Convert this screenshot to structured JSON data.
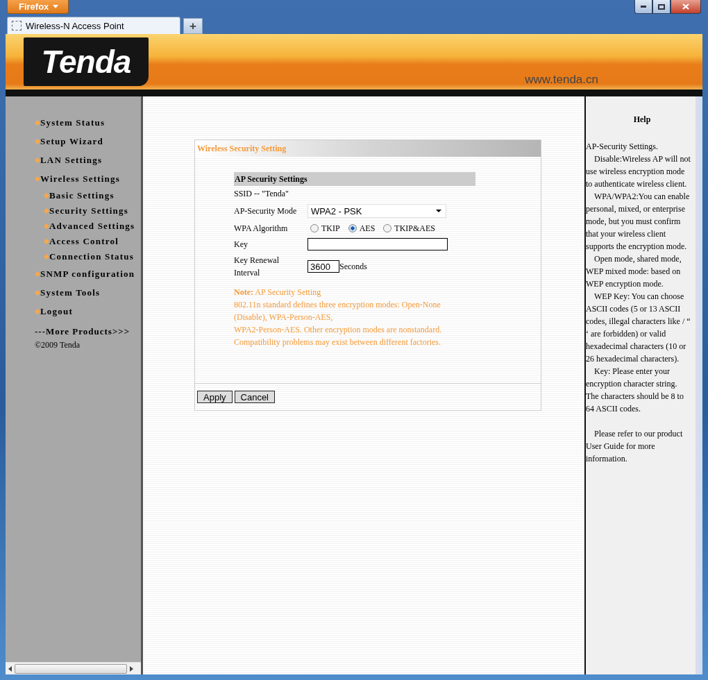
{
  "browser": {
    "menu_button": "Firefox",
    "tabs": [
      {
        "label": "Wireless-N Access Point",
        "selected": true
      }
    ],
    "new_tab": "+"
  },
  "banner": {
    "logo": "Tenda",
    "url": "www.tenda.cn"
  },
  "sidebar": {
    "items": [
      {
        "label": "System Status"
      },
      {
        "label": "Setup Wizard"
      },
      {
        "label": "LAN Settings"
      },
      {
        "label": "Wireless Settings",
        "children": [
          {
            "label": "Basic Settings"
          },
          {
            "label": "Security Settings"
          },
          {
            "label": "Advanced Settings"
          },
          {
            "label": "Access Control"
          },
          {
            "label": "Connection Status"
          }
        ]
      },
      {
        "label": "SNMP configuration"
      },
      {
        "label": "System Tools"
      },
      {
        "label": "Logout"
      }
    ],
    "more": "---More Products>>>",
    "copyright": "©2009 Tenda"
  },
  "panel": {
    "title": "Wireless Security Setting",
    "section": "AP Security Settings",
    "ssid": "SSID -- \"Tenda\"",
    "mode_label": "AP-Security Mode",
    "mode_value": "WPA2 - PSK",
    "algorithm_label": "WPA Algorithm",
    "algorithms": [
      {
        "label": "TKIP",
        "selected": false
      },
      {
        "label": "AES",
        "selected": true
      },
      {
        "label": "TKIP&AES",
        "selected": false
      }
    ],
    "key_label": "Key",
    "interval_label": "Key Renewal Interval",
    "interval_value": "3600",
    "interval_unit": "Seconds",
    "note": [
      "**Note:**  AP Security Setting",
      "802.11n standard defines three encryption modes: Open-None (Disable), WPA-Person-AES,",
      "WPA2-Person-AES. Other encryption modes are nonstandard.",
      "Compatibility problems may exist between different factories."
    ],
    "buttons": [
      "Apply",
      "Cancel"
    ]
  },
  "help": {
    "title": "Help",
    "heading": "AP-Security Settings.",
    "paragraphs": [
      "Disable:Wireless AP will not use wireless encryption mode to authenticate wireless client.",
      "WPA/WPA2:You can enable personal, mixed, or enterprise mode, but you must confirm that your wireless client supports the encryption mode.",
      "Open mode, shared mode, WEP mixed mode: based on WEP encryption mode.",
      "WEP Key: You can choose ASCII codes (5 or 13 ASCII codes, illegal characters like / “ ‘ are forbidden) or valid hexadecimal characters (10 or 26 hexadecimal characters).",
      "Key: Please enter your encryption character string. The characters should be 8 to 64 ASCII codes."
    ],
    "closing": "Please refer to our product User Guide for more information."
  }
}
